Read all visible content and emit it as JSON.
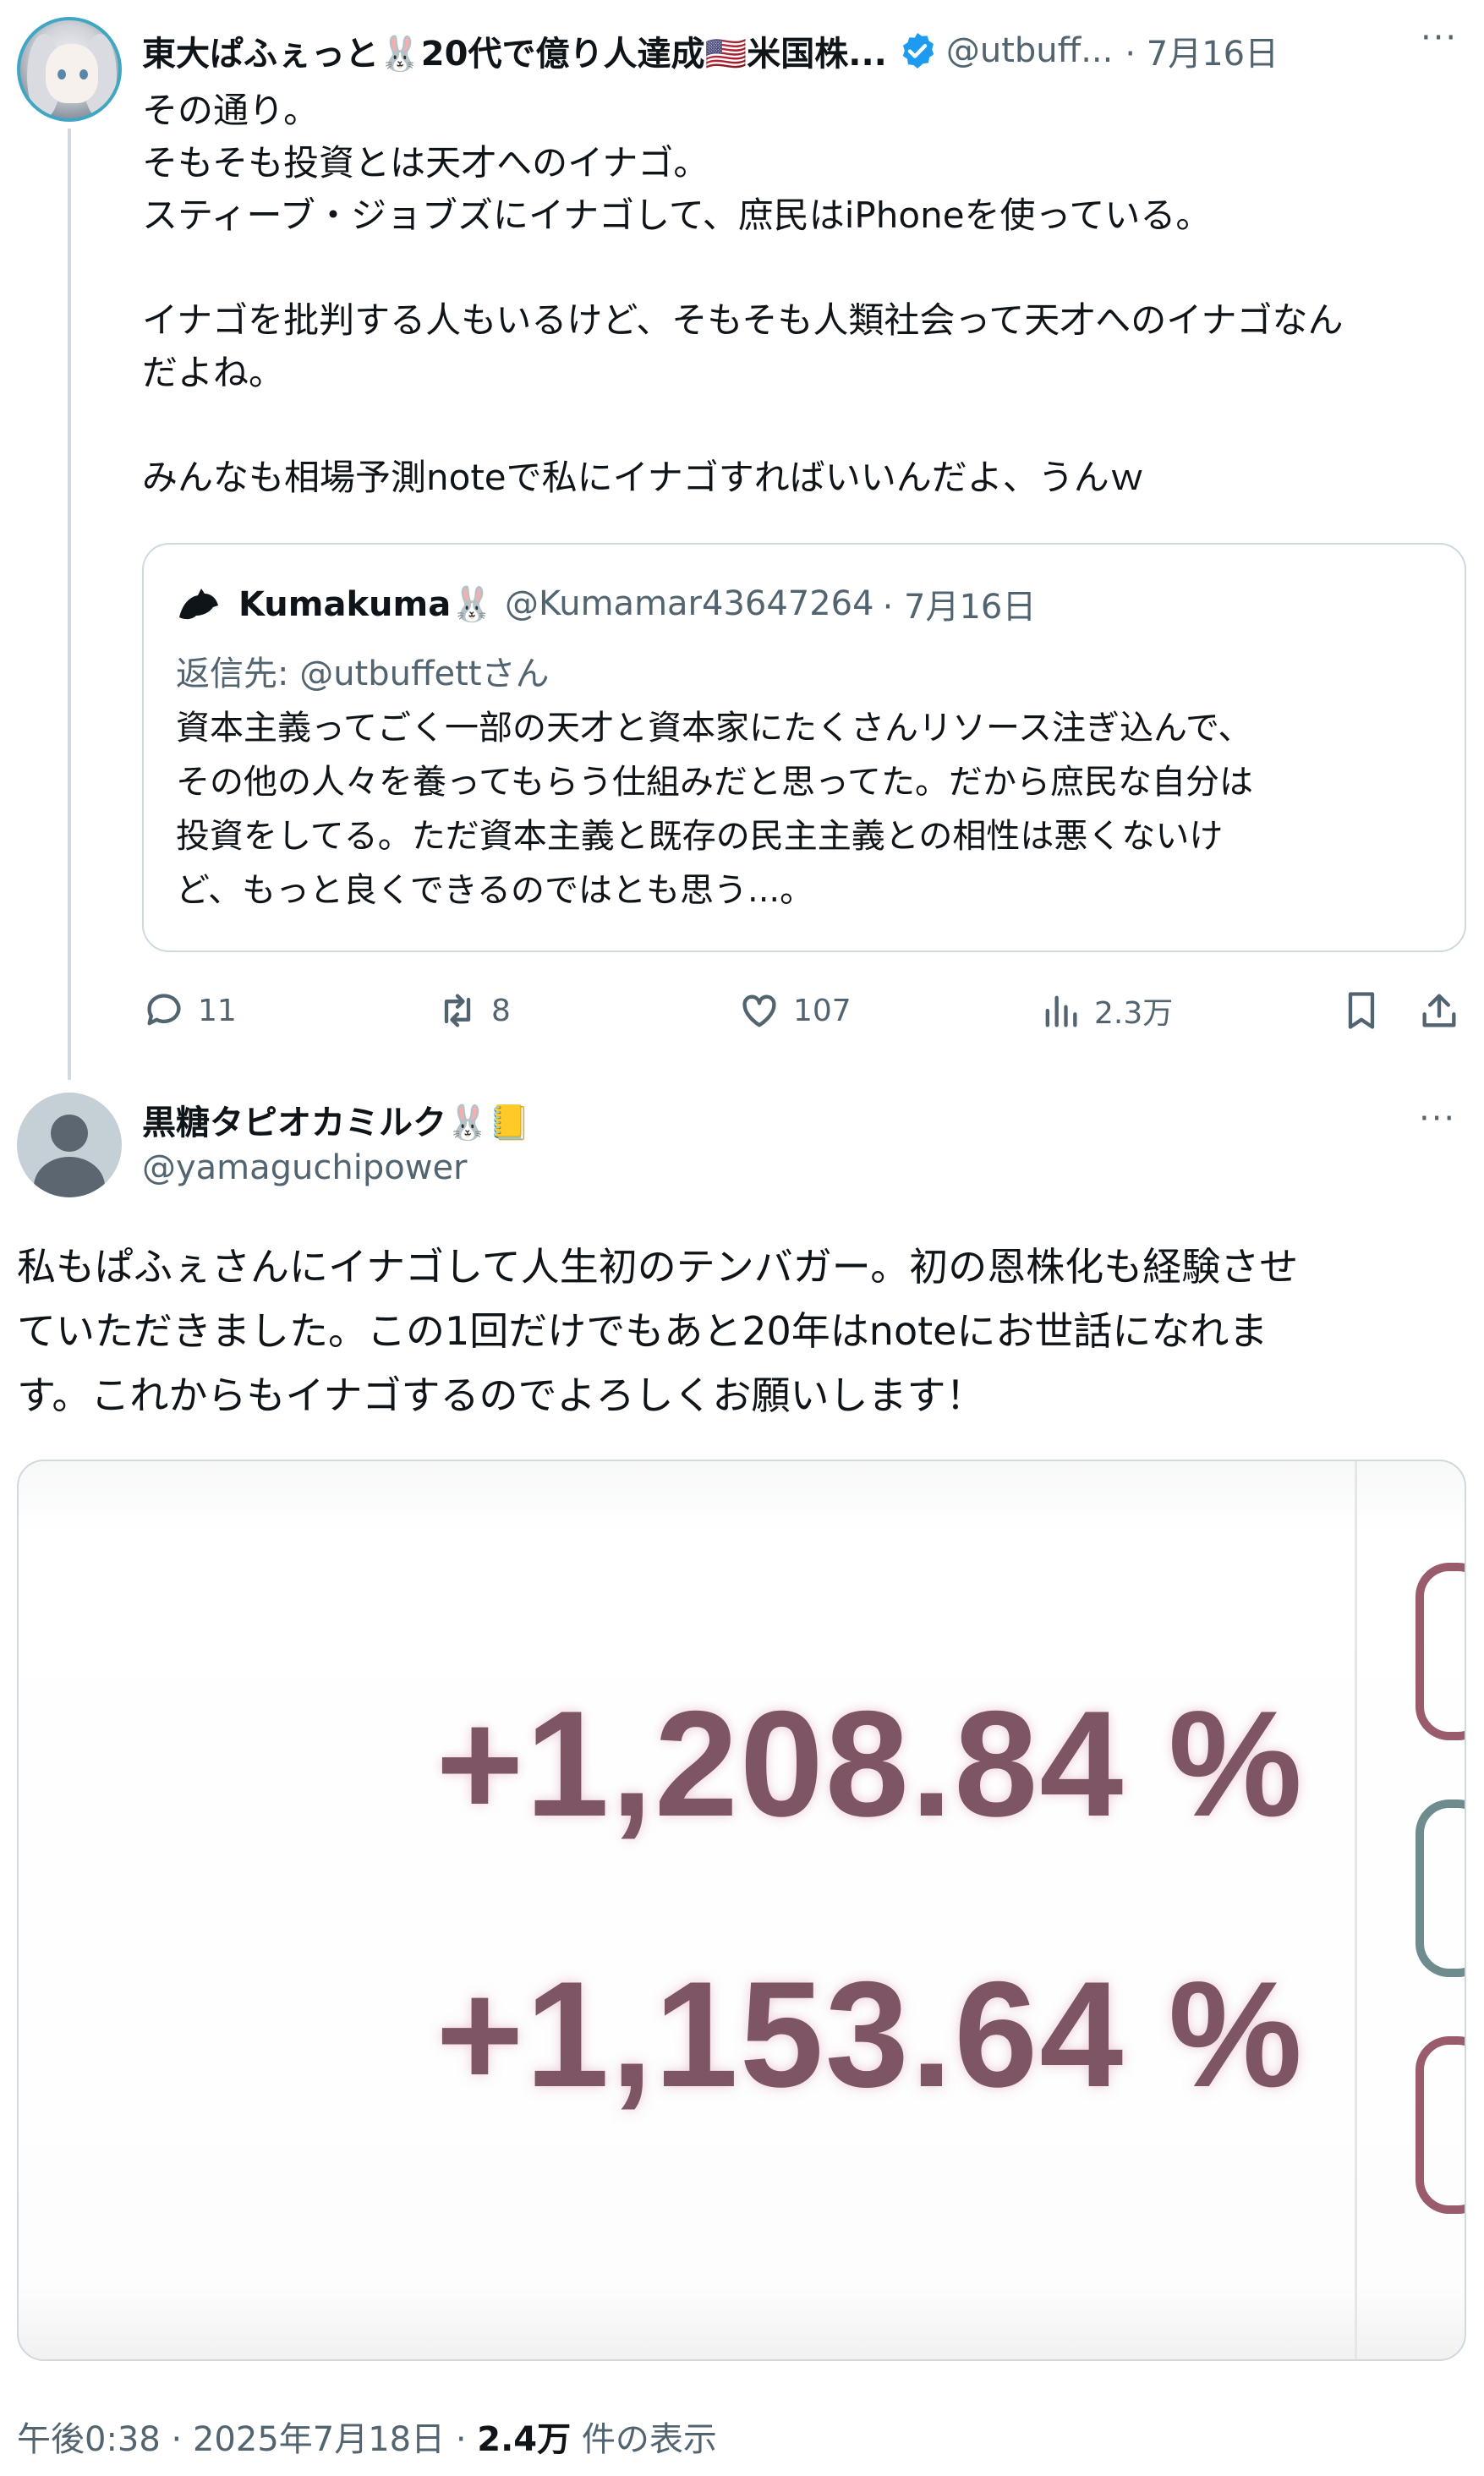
{
  "parent": {
    "display_name": "東大ぱふぇっと🐰20代で億り人達成🇺🇸米国株...",
    "handle": "@utbuff...",
    "date": "· 7月16日",
    "menu": "···",
    "lines": [
      "その通り。",
      "そもそも投資とは天才へのイナゴ。",
      "スティーブ・ジョブズにイナゴして、庶民はiPhoneを使っている。",
      "",
      "イナゴを批判する人もいるけど、そもそも人類社会って天才へのイナゴなん",
      "だよね。",
      "",
      "みんなも相場予測noteで私にイナゴすればいいんだよ、うんｗ"
    ],
    "quote": {
      "name": "Kumakuma🐰",
      "handle": "@Kumamar43647264",
      "date": "· 7月16日",
      "reply_to": "返信先: @utbuffettさん",
      "lines": [
        "資本主義ってごく一部の天才と資本家にたくさんリソース注ぎ込んで、",
        "その他の人々を養ってもらう仕組みだと思ってた。だから庶民な自分は",
        "投資をしてる。ただ資本主義と既存の民主主義との相性は悪くないけ",
        "ど、もっと良くできるのではとも思う...。"
      ]
    },
    "actions": {
      "replies": "11",
      "retweets": "8",
      "likes": "107",
      "views": "2.3万"
    }
  },
  "reply": {
    "display_name": "黒糖タピオカミルク🐰📒",
    "handle": "@yamaguchipower",
    "menu": "···",
    "lines": [
      "私もぱふぇさんにイナゴして人生初のテンバガー。初の恩株化も経験させ",
      "ていただきました。この1回だけでもあと20年はnoteにお世話になれま",
      "す。これからもイナゴするのでよろしくお願いします！"
    ],
    "media": {
      "value1": "+1,208.84 %",
      "value2": "+1,153.64 %"
    },
    "footer": {
      "time": "午後0:38 · 2025年7月18日 · ",
      "views": "2.4万",
      "views_label": " 件の表示"
    }
  },
  "colors": {
    "text": "#0f1419",
    "muted": "#536471",
    "border": "#cfd9de",
    "verified": "#1d9bf0",
    "percent": "#7d5565"
  },
  "icons": [
    "verified-badge-icon",
    "reply-icon",
    "retweet-icon",
    "like-icon",
    "views-icon",
    "bookmark-icon",
    "share-icon",
    "more-icon"
  ]
}
